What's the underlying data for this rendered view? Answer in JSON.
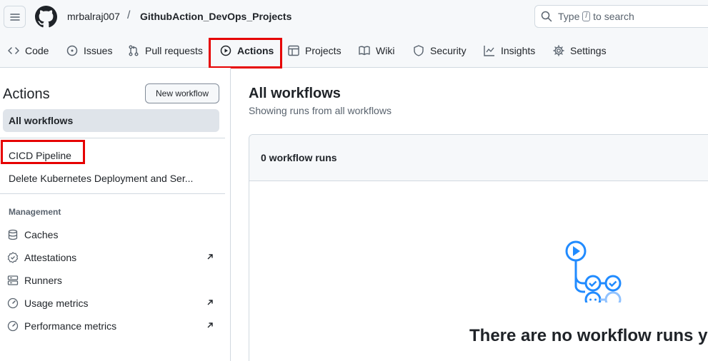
{
  "header": {
    "owner": "mrbalraj007",
    "separator": "/",
    "repo": "GithubAction_DevOps_Projects",
    "search": {
      "prefix": "Type",
      "key": "/",
      "suffix": "to search"
    }
  },
  "tabs": [
    {
      "label": "Code",
      "icon": "code-icon"
    },
    {
      "label": "Issues",
      "icon": "issue-icon"
    },
    {
      "label": "Pull requests",
      "icon": "pull-request-icon"
    },
    {
      "label": "Actions",
      "icon": "play-icon",
      "active": true
    },
    {
      "label": "Projects",
      "icon": "table-icon"
    },
    {
      "label": "Wiki",
      "icon": "book-icon"
    },
    {
      "label": "Security",
      "icon": "shield-icon"
    },
    {
      "label": "Insights",
      "icon": "graph-icon"
    },
    {
      "label": "Settings",
      "icon": "gear-icon"
    }
  ],
  "sidebar": {
    "title": "Actions",
    "new_workflow": "New workflow",
    "all_workflows": "All workflows",
    "workflows": [
      "CICD Pipeline",
      "Delete Kubernetes Deployment and Ser..."
    ],
    "management_heading": "Management",
    "management": [
      {
        "label": "Caches",
        "icon": "database-icon",
        "external": false
      },
      {
        "label": "Attestations",
        "icon": "verified-icon",
        "external": true
      },
      {
        "label": "Runners",
        "icon": "server-icon",
        "external": false
      },
      {
        "label": "Usage metrics",
        "icon": "meter-icon",
        "external": true
      },
      {
        "label": "Performance metrics",
        "icon": "meter-icon",
        "external": true
      }
    ]
  },
  "main": {
    "title": "All workflows",
    "subtitle": "Showing runs from all workflows",
    "runs_count": "0 workflow runs",
    "empty_message": "There are no workflow runs yet"
  },
  "colors": {
    "highlight_box": "#e60000",
    "accent_blue": "#218bff",
    "active_tab_underline": "#fd8c73"
  }
}
